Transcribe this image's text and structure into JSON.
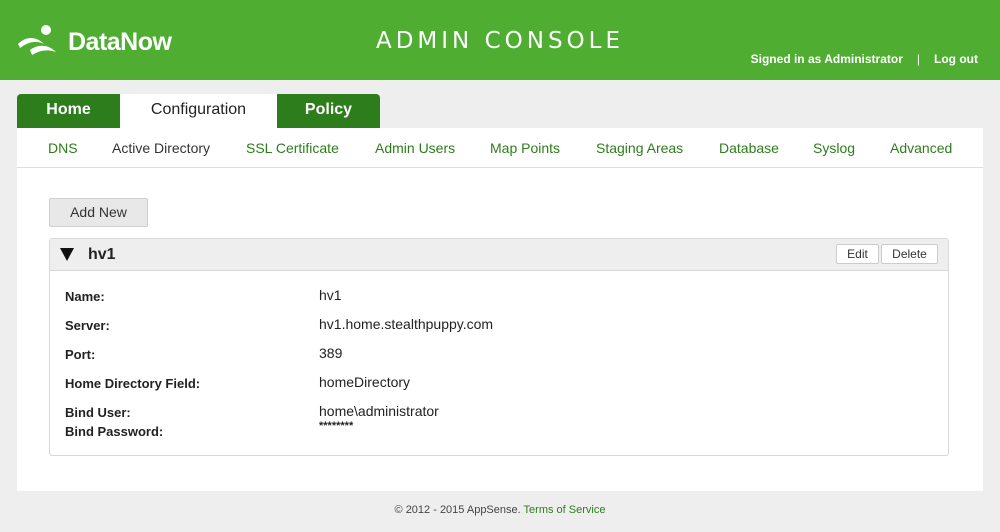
{
  "header": {
    "brand": "DataNow",
    "title": "ADMIN CONSOLE",
    "signed_in": "Signed in as Administrator",
    "separator": "|",
    "logout": "Log out"
  },
  "tabs": [
    {
      "label": "Home"
    },
    {
      "label": "Configuration"
    },
    {
      "label": "Policy"
    }
  ],
  "subnav": [
    {
      "label": "DNS"
    },
    {
      "label": "Active Directory",
      "current": true
    },
    {
      "label": "SSL Certificate"
    },
    {
      "label": "Admin Users"
    },
    {
      "label": "Map Points"
    },
    {
      "label": "Staging Areas"
    },
    {
      "label": "Database"
    },
    {
      "label": "Syslog"
    },
    {
      "label": "Advanced"
    }
  ],
  "actions": {
    "add_new": "Add New"
  },
  "entry": {
    "title": "hv1",
    "edit": "Edit",
    "delete": "Delete",
    "fields": [
      {
        "label": "Name:",
        "value": "hv1"
      },
      {
        "label": "Server:",
        "value": "hv1.home.stealthpuppy.com"
      },
      {
        "label": "Port:",
        "value": "389"
      },
      {
        "label": "Home Directory Field:",
        "value": "homeDirectory"
      },
      {
        "label": "Bind User:",
        "value": "home\\administrator"
      },
      {
        "label": "Bind Password:",
        "value": "********"
      }
    ]
  },
  "footer": {
    "copyright": "© 2012 - 2015 AppSense.",
    "terms": "Terms of Service"
  },
  "colors": {
    "brand_green": "#4fae32",
    "dark_green": "#2e7d1c"
  },
  "icons": {
    "logo": "datanow-logo-icon",
    "toggle": "collapse-triangle-icon"
  }
}
